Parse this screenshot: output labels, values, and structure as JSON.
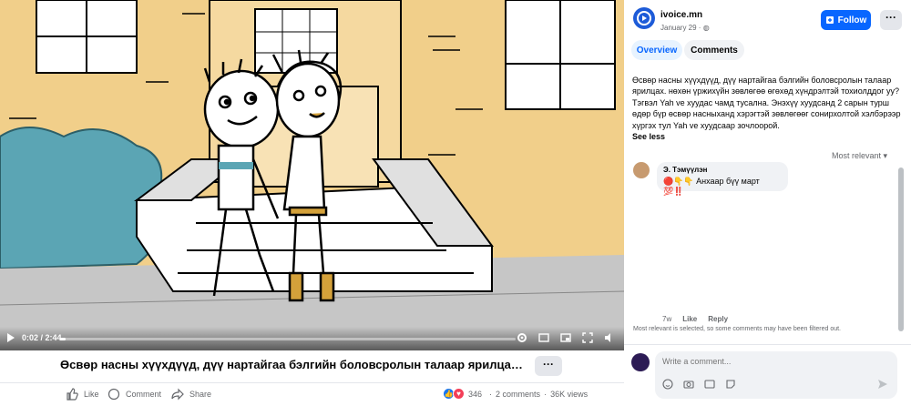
{
  "video": {
    "time": "0:02 / 2:44",
    "progress": 0.012,
    "title": "Өсвөр насны хүүхдүүд, дүү нартайгаа бэлгийн боловсролын талаар ярилцах, н...",
    "more_label": "···"
  },
  "actions": {
    "like": "Like",
    "comment": "Comment",
    "share": "Share",
    "reaction_count": "346",
    "comments_count": "2 comments",
    "views": "36K views"
  },
  "post": {
    "page_name": "ivoice.mn",
    "date": "January 29 · ",
    "follow_label": "Follow",
    "menu_label": "···",
    "tabs": [
      "Overview",
      "Comments"
    ],
    "text": "Өсвөр насны хүүхдүүд, дүү нартайгаа бэлгийн боловсролын талаар ярилцах. нөхөн үржихүйн зөвлөгөө өгөхөд хүндрэлтэй тохиолддог уу? Тэгвэл Yah ve хуудас чамд тусална. Энэхүү хуудсанд 2 сарын турш өдөр бүр өсвөр насныханд хэрэгтэй зөвлөгөөг сонирхолтой хэлбэрээр хүргэх тул Yah ve хуудсаар зочлоорой.",
    "see_less": "See less"
  },
  "comments": {
    "sort_label": "Most relevant ▾",
    "items": [
      {
        "author": "Э. Тэмүүлэн",
        "text": "🔴👇👇 Анхаар бүү март 💯‼️",
        "age": "7w",
        "like": "Like",
        "reply": "Reply"
      }
    ],
    "filter_note": "Most relevant is selected, so some comments may have been filtered out.",
    "input_placeholder": "Write a comment..."
  },
  "colors": {
    "accent": "#0866ff",
    "sky": "#e9d5a8",
    "building": "#f0cc86",
    "bush": "#5ba5b4",
    "pavement": "#c6c6c6"
  },
  "icons": {
    "video": [
      "settings-icon",
      "caption-icon",
      "pip-icon",
      "fullscreen-icon",
      "volume-icon"
    ],
    "composer": [
      "emoji-icon",
      "camera-icon",
      "gif-icon",
      "sticker-icon"
    ]
  }
}
